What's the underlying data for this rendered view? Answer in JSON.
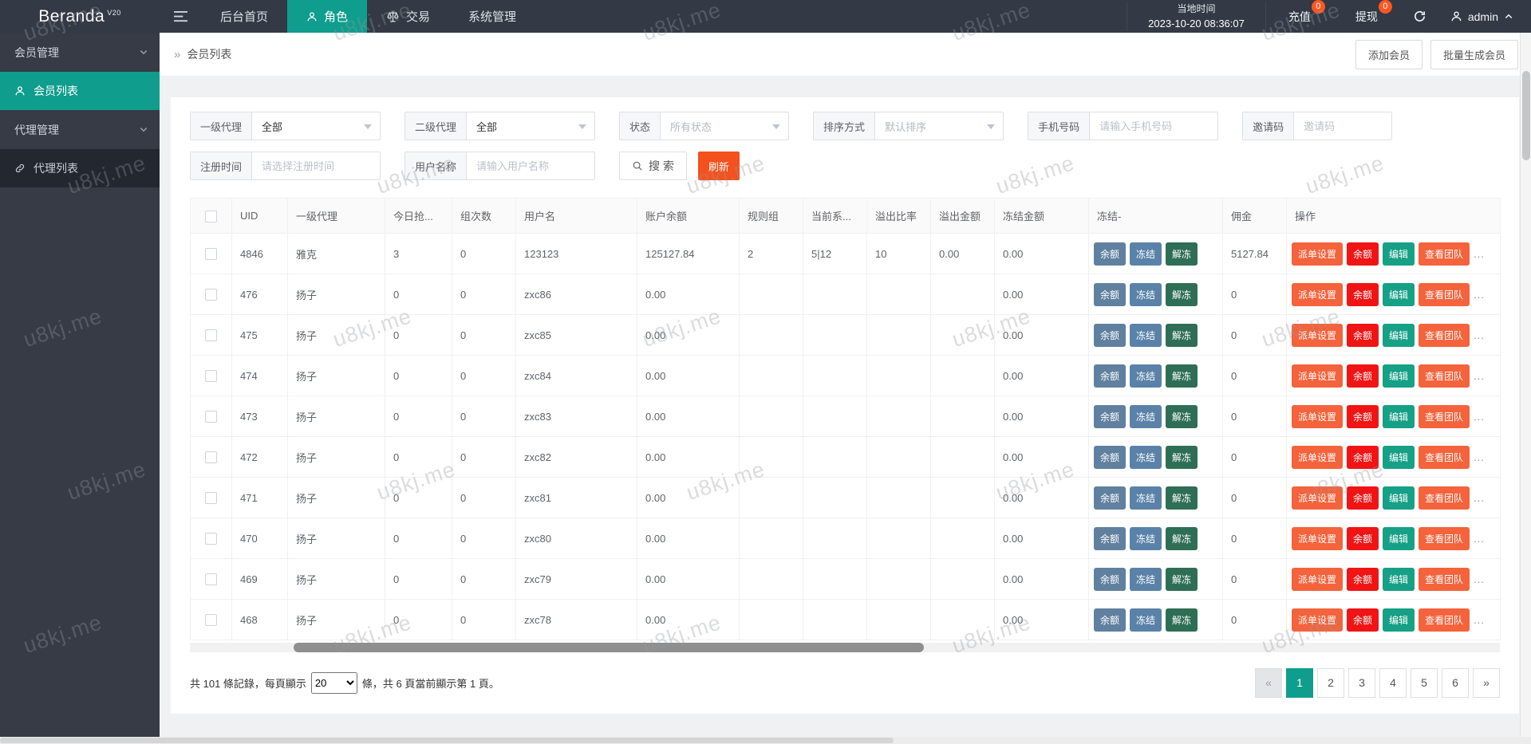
{
  "navbar": {
    "logo": "Beranda",
    "logo_version": "V20",
    "menu": [
      {
        "label": "后台首页",
        "icon": null,
        "active": false
      },
      {
        "label": "角色",
        "icon": "person",
        "active": true
      },
      {
        "label": "交易",
        "icon": "scale",
        "active": false
      },
      {
        "label": "系统管理",
        "icon": null,
        "active": false
      }
    ],
    "local_time_label": "当地时间",
    "local_time_value": "2023-10-20 08:36:07",
    "recharge_label": "充值",
    "recharge_badge": "0",
    "withdraw_label": "提现",
    "withdraw_badge": "0",
    "user_name": "admin"
  },
  "sidebar": {
    "groups": [
      {
        "label": "会员管理",
        "items": [
          {
            "label": "会员列表",
            "icon": "person",
            "active": true
          }
        ]
      },
      {
        "label": "代理管理",
        "items": [
          {
            "label": "代理列表",
            "icon": "link",
            "active": false
          }
        ]
      }
    ]
  },
  "breadcrumb": {
    "arrow": "»",
    "title": "会员列表",
    "add_member": "添加会员",
    "batch_generate": "批量生成会员"
  },
  "filters": {
    "row1": [
      {
        "label": "一级代理",
        "type": "select",
        "value": "全部",
        "muted": false
      },
      {
        "label": "二级代理",
        "type": "select",
        "value": "全部",
        "muted": false
      },
      {
        "label": "状态",
        "type": "select",
        "value": "所有状态",
        "muted": true
      },
      {
        "label": "排序方式",
        "type": "select",
        "value": "默认排序",
        "muted": true
      },
      {
        "label": "手机号码",
        "type": "input",
        "placeholder": "请输入手机号码"
      },
      {
        "label": "邀请码",
        "type": "input",
        "placeholder": "邀请码"
      }
    ],
    "row2": [
      {
        "label": "注册时间",
        "type": "input",
        "placeholder": "请选择注册时间"
      },
      {
        "label": "用户名称",
        "type": "input",
        "placeholder": "请输入用户名称"
      }
    ],
    "search_label": "搜 索",
    "refresh_label": "刷新"
  },
  "table": {
    "columns": [
      "UID",
      "一级代理",
      "今日抢...",
      "组次数",
      "用户名",
      "账户余额",
      "规则组",
      "当前系...",
      "溢出比率",
      "溢出金额",
      "冻结金额",
      "冻结-",
      "佣金",
      "操作"
    ],
    "freeze_buttons": [
      "余额",
      "冻结",
      "解冻"
    ],
    "action_buttons": [
      "派单设置",
      "余额",
      "编辑",
      "查看团队"
    ],
    "action_more": "...",
    "rows": [
      {
        "uid": "4846",
        "agent": "雅克",
        "today": "3",
        "group_count": "0",
        "username": "123123",
        "balance": "125127.84",
        "rule_group": "2",
        "current_sys": "5|12",
        "overflow_rate": "10",
        "overflow_amount": "0.00",
        "frozen_amount": "0.00",
        "commission": "5127.84"
      },
      {
        "uid": "476",
        "agent": "扬子",
        "today": "0",
        "group_count": "0",
        "username": "zxc86",
        "balance": "0.00",
        "rule_group": "",
        "current_sys": "",
        "overflow_rate": "",
        "overflow_amount": "",
        "frozen_amount": "0.00",
        "commission": "0"
      },
      {
        "uid": "475",
        "agent": "扬子",
        "today": "0",
        "group_count": "0",
        "username": "zxc85",
        "balance": "0.00",
        "rule_group": "",
        "current_sys": "",
        "overflow_rate": "",
        "overflow_amount": "",
        "frozen_amount": "0.00",
        "commission": "0"
      },
      {
        "uid": "474",
        "agent": "扬子",
        "today": "0",
        "group_count": "0",
        "username": "zxc84",
        "balance": "0.00",
        "rule_group": "",
        "current_sys": "",
        "overflow_rate": "",
        "overflow_amount": "",
        "frozen_amount": "0.00",
        "commission": "0"
      },
      {
        "uid": "473",
        "agent": "扬子",
        "today": "0",
        "group_count": "0",
        "username": "zxc83",
        "balance": "0.00",
        "rule_group": "",
        "current_sys": "",
        "overflow_rate": "",
        "overflow_amount": "",
        "frozen_amount": "0.00",
        "commission": "0"
      },
      {
        "uid": "472",
        "agent": "扬子",
        "today": "0",
        "group_count": "0",
        "username": "zxc82",
        "balance": "0.00",
        "rule_group": "",
        "current_sys": "",
        "overflow_rate": "",
        "overflow_amount": "",
        "frozen_amount": "0.00",
        "commission": "0"
      },
      {
        "uid": "471",
        "agent": "扬子",
        "today": "0",
        "group_count": "0",
        "username": "zxc81",
        "balance": "0.00",
        "rule_group": "",
        "current_sys": "",
        "overflow_rate": "",
        "overflow_amount": "",
        "frozen_amount": "0.00",
        "commission": "0"
      },
      {
        "uid": "470",
        "agent": "扬子",
        "today": "0",
        "group_count": "0",
        "username": "zxc80",
        "balance": "0.00",
        "rule_group": "",
        "current_sys": "",
        "overflow_rate": "",
        "overflow_amount": "",
        "frozen_amount": "0.00",
        "commission": "0"
      },
      {
        "uid": "469",
        "agent": "扬子",
        "today": "0",
        "group_count": "0",
        "username": "zxc79",
        "balance": "0.00",
        "rule_group": "",
        "current_sys": "",
        "overflow_rate": "",
        "overflow_amount": "",
        "frozen_amount": "0.00",
        "commission": "0"
      },
      {
        "uid": "468",
        "agent": "扬子",
        "today": "0",
        "group_count": "0",
        "username": "zxc78",
        "balance": "0.00",
        "rule_group": "",
        "current_sys": "",
        "overflow_rate": "",
        "overflow_amount": "",
        "frozen_amount": "0.00",
        "commission": "0"
      }
    ]
  },
  "pagination": {
    "summary_prefix": "共 101 條記錄，每頁顯示",
    "per_page": "20",
    "summary_suffix": "條，共 6 頁當前顯示第 1 頁。",
    "pages": [
      "1",
      "2",
      "3",
      "4",
      "5",
      "6"
    ],
    "active_page": "1",
    "prev": "«",
    "next": "»"
  },
  "watermark": {
    "text": "u8kj.me"
  },
  "colors": {
    "accent": "#0f9d8d",
    "navbar_bg": "#333a45",
    "sidebar_bg": "#363b46",
    "sidebar_item_bg": "#23272f",
    "orange": "#f4511e",
    "badge": "#ff5722",
    "action_orange": "#f4633c",
    "action_red": "#f01414",
    "action_teal": "#16a085",
    "freeze_slate": "#60809f",
    "freeze_blue": "#5a82a8",
    "freeze_green": "#2e6e55"
  }
}
